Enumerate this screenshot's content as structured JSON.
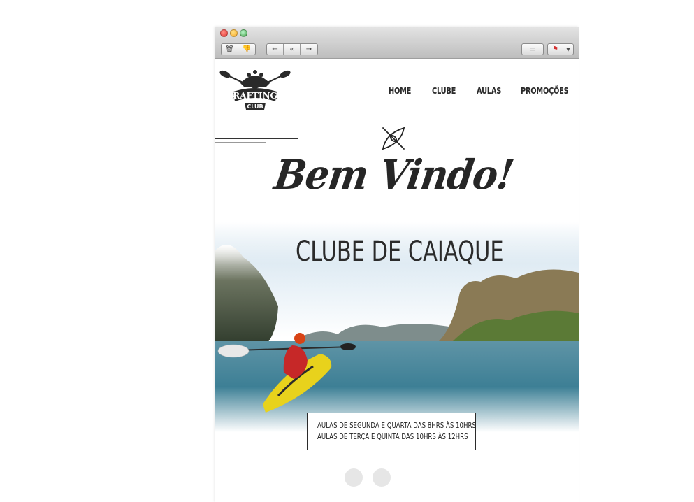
{
  "toolbar": {
    "buttons": [
      "delete-icon",
      "junk-icon",
      "reply-icon",
      "reply-all-icon",
      "forward-icon",
      "print-icon",
      "flag-icon"
    ]
  },
  "email": {
    "logo": {
      "line1": "RAFTING",
      "line2": "CLUB"
    },
    "nav": [
      "HOME",
      "CLUBE",
      "AULAS",
      "PROMOÇÕES"
    ],
    "headline": "Bem Vindo!",
    "subheadline": "CLUBE DE CAIAQUE",
    "schedule": [
      "AULAS DE SEGUNDA E QUARTA DAS 8HRS ÀS 10HRS",
      "AULAS DE TERÇA E QUINTA DAS 10HRS ÀS 12HRS"
    ]
  },
  "colors": {
    "text": "#262626",
    "kayak": "#e8d21c",
    "water": "#3d7f95",
    "toolbar": "#c9c9c9"
  }
}
